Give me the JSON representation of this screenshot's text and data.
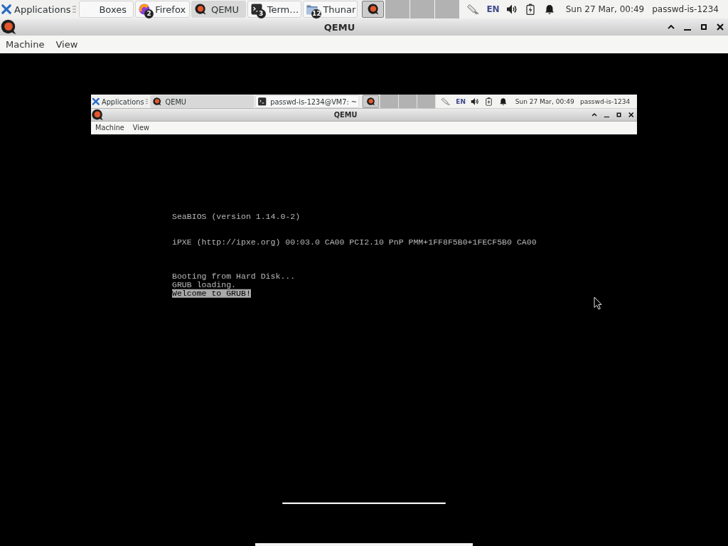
{
  "panel": {
    "menu_label": "Applications",
    "tasks": [
      {
        "kind": "boxes",
        "label": "Boxes",
        "selected": false
      },
      {
        "kind": "browser",
        "label": "Firefox",
        "badge": "2",
        "selected": false
      },
      {
        "kind": "emulator",
        "label": "QEMU",
        "selected": true
      },
      {
        "kind": "terminal",
        "label": "Term…",
        "badge": "3",
        "selected": false
      },
      {
        "kind": "files",
        "label": "Thunar",
        "badge": "12",
        "selected": false
      }
    ],
    "keyboard_layout": "EN",
    "clock": "Sun 27 Mar, 00:49",
    "user": "passwd-is-1234"
  },
  "window": {
    "title": "QEMU",
    "menu": [
      "Machine",
      "View"
    ]
  },
  "guest": {
    "panel": {
      "menu_label": "Applications",
      "tasks": [
        {
          "kind": "emulator",
          "label": "QEMU",
          "selected": true
        },
        {
          "kind": "terminal",
          "label": "passwd-is-1234@VM7: ~",
          "selected": false
        }
      ],
      "keyboard_layout": "EN",
      "clock": "Sun 27 Mar, 00:49",
      "user": "passwd-is-1234"
    },
    "window": {
      "title": "QEMU",
      "menu": [
        "Machine",
        "View"
      ]
    },
    "console": {
      "blocks": [
        [
          {
            "text": "SeaBIOS (version 1.14.0-2)",
            "highlighted": false
          }
        ],
        [
          {
            "text": "iPXE (http://ipxe.org) 00:03.0 CA00 PCI2.10 PnP PMM+1FF8F5B0+1FECF5B0 CA00",
            "highlighted": false
          }
        ],
        [
          {
            "text": "Booting from Hard Disk...",
            "highlighted": false
          },
          {
            "text": "GRUB loading.",
            "highlighted": false
          },
          {
            "text": "Welcome to GRUB!",
            "highlighted": true
          }
        ]
      ]
    }
  }
}
